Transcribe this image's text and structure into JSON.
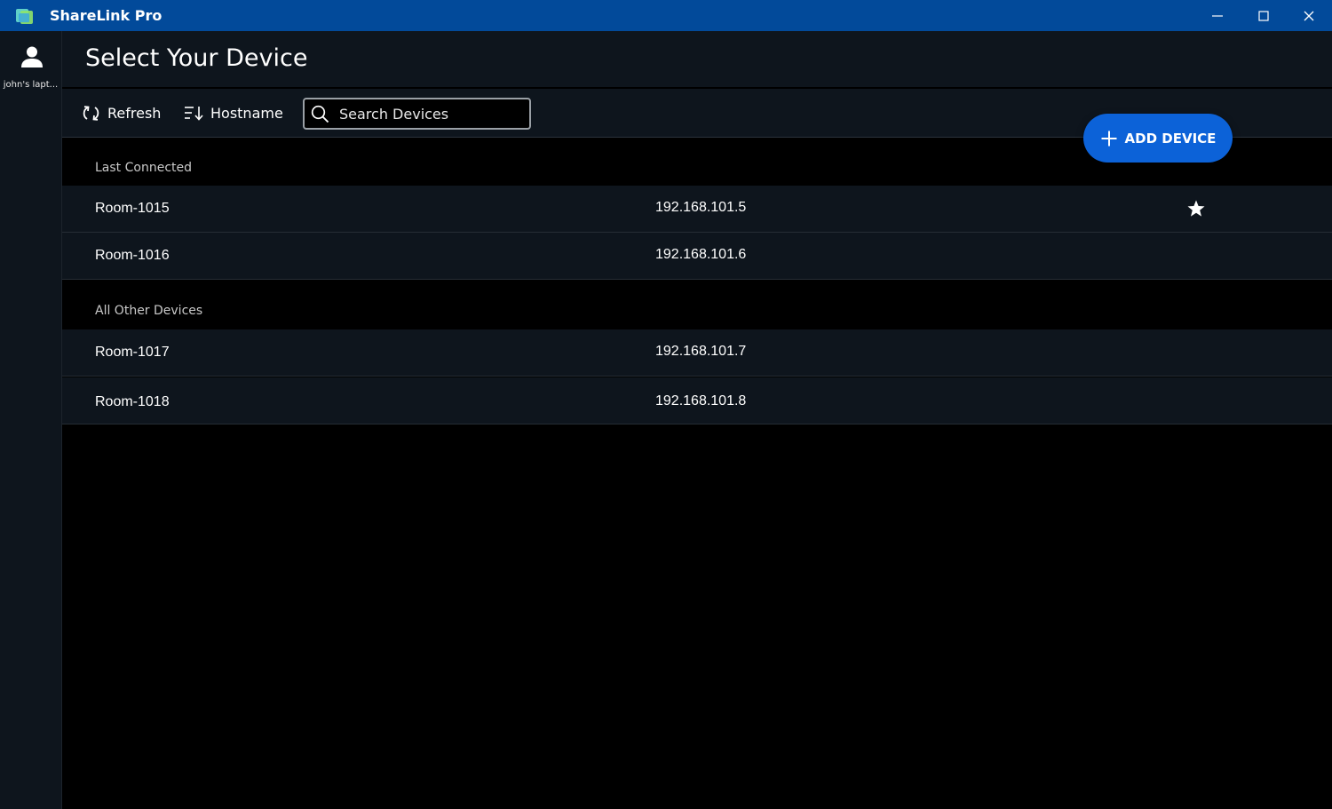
{
  "window": {
    "title": "ShareLink Pro",
    "accent": "#024a9a",
    "controls": [
      "minimize-icon",
      "maximize-icon",
      "close-icon"
    ]
  },
  "sidebar": {
    "user_icon": "user-icon",
    "user_name": "john's lapt..."
  },
  "header": {
    "title": "Select Your Device"
  },
  "toolbar": {
    "refresh_label": "Refresh",
    "refresh_icon": "refresh-icon",
    "sort_label": "Hostname",
    "sort_icon": "sort-descending-icon",
    "search_placeholder": "Search Devices",
    "search_icon": "search-icon"
  },
  "add_device": {
    "label": "ADD DEVICE",
    "icon": "plus-icon",
    "color": "#0c62d8"
  },
  "sections": [
    {
      "label": "Last Connected",
      "devices": [
        {
          "name": "Room-1015",
          "ip": "192.168.101.5",
          "favorite": true
        },
        {
          "name": "Room-1016",
          "ip": "192.168.101.6",
          "favorite": false
        }
      ]
    },
    {
      "label": "All Other Devices",
      "devices": [
        {
          "name": "Room-1017",
          "ip": "192.168.101.7",
          "favorite": false
        },
        {
          "name": "Room-1018",
          "ip": "192.168.101.8",
          "favorite": false
        }
      ]
    }
  ]
}
